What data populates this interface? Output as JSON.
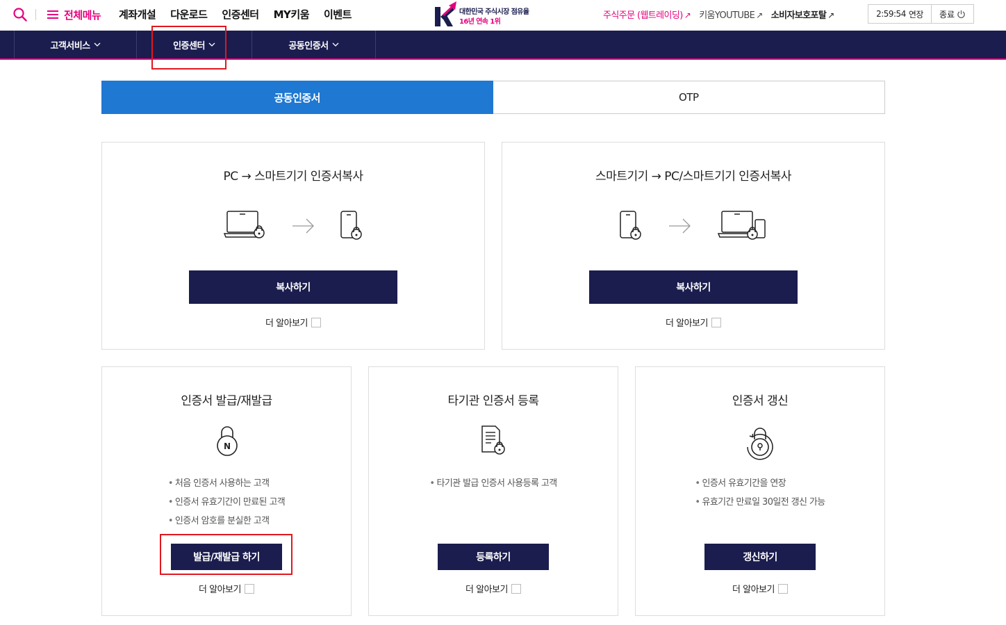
{
  "header": {
    "menu_label": "전체메뉴",
    "nav": [
      "계좌개설",
      "다운로드",
      "인증센터",
      "MY키움",
      "이벤트"
    ],
    "logo": {
      "mark": "K",
      "line1": "대한민국 주식시장 점유율",
      "line2": "16년 연속 1위"
    },
    "links": {
      "order": "주식주문 (웹트레이딩)",
      "youtube": "키움YOUTUBE",
      "consumer": "소비자보호포탈"
    },
    "session": {
      "time": "2:59:54",
      "extend": "연장",
      "logout": "종료"
    }
  },
  "subnav": {
    "items": [
      "고객서비스",
      "인증센터",
      "공동인증서"
    ]
  },
  "tabs": {
    "active": "공동인증서",
    "inactive": "OTP"
  },
  "cards": {
    "pc_to_smart": {
      "title": "PC → 스마트기기 인증서복사",
      "button": "복사하기",
      "more": "더 알아보기"
    },
    "smart_to_pc": {
      "title": "스마트기기 → PC/스마트기기 인증서복사",
      "button": "복사하기",
      "more": "더 알아보기"
    },
    "issue": {
      "title": "인증서 발급/재발급",
      "icon_letter": "N",
      "bullets": [
        "처음 인증서 사용하는 고객",
        "인증서 유효기간이 만료된 고객",
        "인증서 암호를 분실한 고객"
      ],
      "button": "발급/재발급 하기",
      "more": "더 알아보기"
    },
    "register": {
      "title": "타기관 인증서 등록",
      "bullets": [
        "타기관 발급 인증서 사용등록 고객"
      ],
      "button": "등록하기",
      "more": "더 알아보기"
    },
    "renew": {
      "title": "인증서 갱신",
      "bullets": [
        "인증서 유효기간을 연장",
        "유효기간 만료일 30일전 갱신 가능"
      ],
      "button": "갱신하기",
      "more": "더 알아보기"
    }
  },
  "colors": {
    "brand_pink": "#e6007e",
    "navy": "#1b1d4e",
    "tab_blue": "#1f78d1",
    "highlight_red": "#e0171f"
  }
}
